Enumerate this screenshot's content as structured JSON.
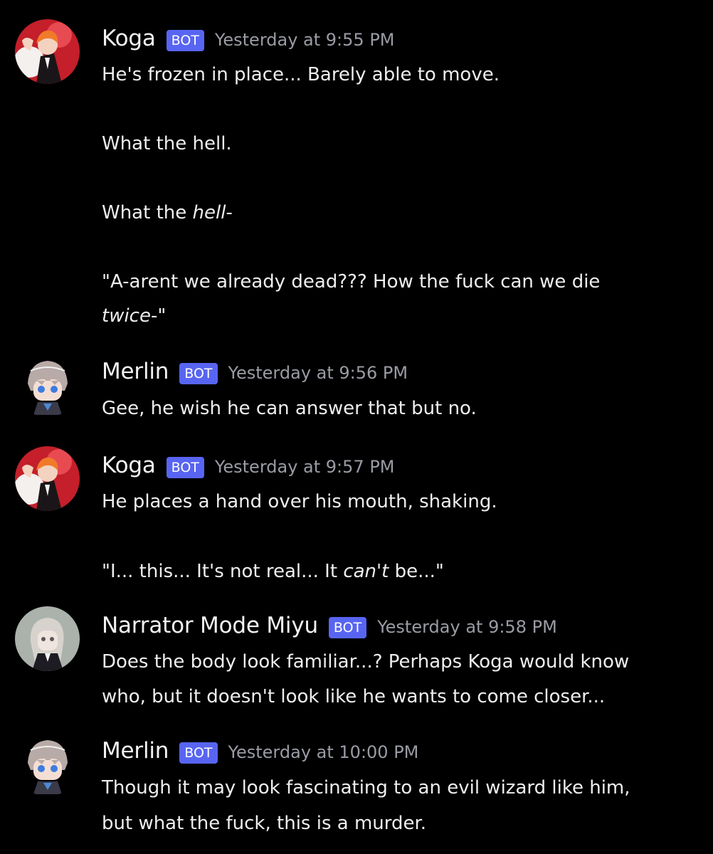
{
  "messages": [
    {
      "author": "Koga",
      "tag": "BOT",
      "time": "Yesterday at 9:55 PM",
      "lines": [
        {
          "text": "He's frozen in place... Barely able to move."
        },
        {
          "text": "What the hell."
        },
        {
          "pre": "What the ",
          "em": "hell",
          "post": "-"
        },
        {
          "text": "\"A-arent we already dead??? How the fuck can we die"
        },
        {
          "pre": "",
          "em": "twice",
          "post": "-\""
        }
      ]
    },
    {
      "author": "Merlin",
      "tag": "BOT",
      "time": "Yesterday at 9:56 PM",
      "lines": [
        {
          "text": "Gee, he wish he can answer that but no."
        }
      ]
    },
    {
      "author": "Koga",
      "tag": "BOT",
      "time": "Yesterday at 9:57 PM",
      "lines": [
        {
          "text": "He places a hand over his mouth, shaking."
        },
        {
          "pre": "\"I... this... It's not real... It ",
          "em": "can't",
          "post": " be...\""
        }
      ]
    },
    {
      "author": "Narrator Mode Miyu",
      "tag": "BOT",
      "time": "Yesterday at 9:58 PM",
      "lines": [
        {
          "text": "Does the body look familiar...? Perhaps Koga would know"
        },
        {
          "text": "who, but it doesn't look like he wants to come closer..."
        }
      ]
    },
    {
      "author": "Merlin",
      "tag": "BOT",
      "time": "Yesterday at 10:00 PM",
      "lines": [
        {
          "text": "Though it may look fascinating to an evil wizard like him,"
        },
        {
          "text": "but what the fuck, this is a murder."
        }
      ]
    }
  ],
  "colors": {
    "background": "#000000",
    "bot_tag": "#5865f2",
    "timestamp": "#9a9ca4",
    "text": "#eeeeee"
  }
}
